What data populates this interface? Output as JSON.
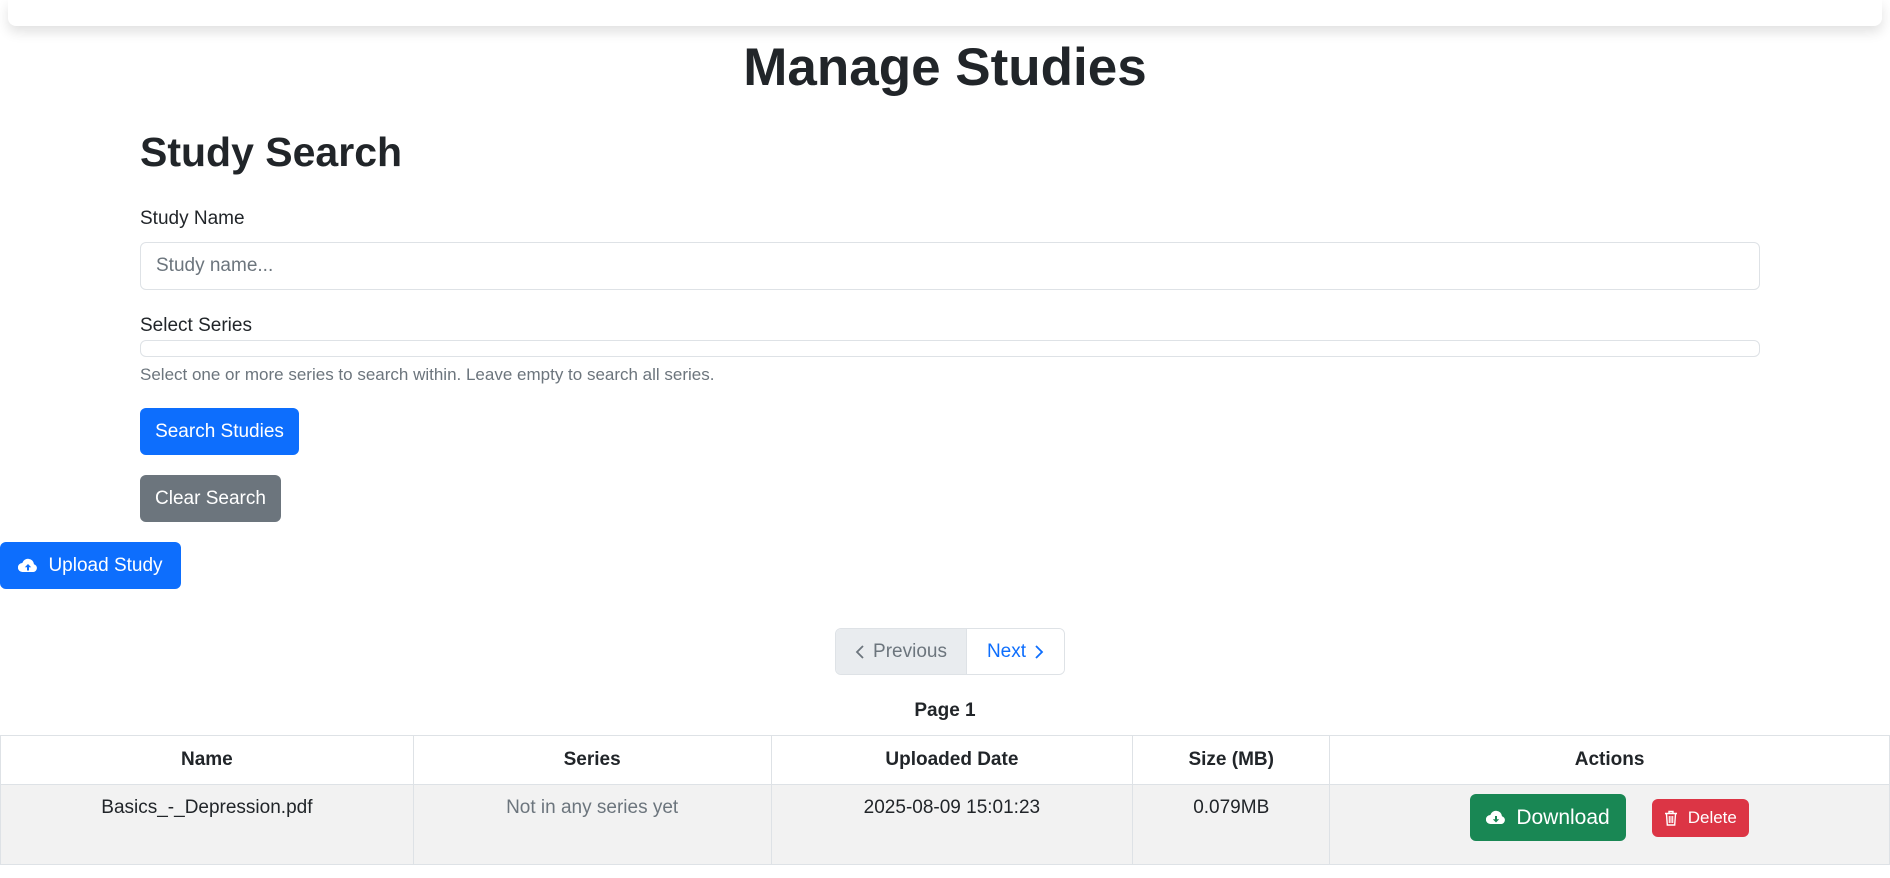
{
  "page": {
    "title": "Manage Studies"
  },
  "search": {
    "title": "Study Search",
    "name_label": "Study Name",
    "name_placeholder": "Study name...",
    "name_value": "",
    "series_label": "Select Series",
    "series_help": "Select one or more series to search within. Leave empty to search all series.",
    "search_button": "Search Studies",
    "clear_button": "Clear Search"
  },
  "upload": {
    "label": "Upload Study",
    "icon": "cloud-upload-icon"
  },
  "pagination": {
    "previous_label": "Previous",
    "next_label": "Next",
    "page_label": "Page 1"
  },
  "table": {
    "columns": [
      "Name",
      "Series",
      "Uploaded Date",
      "Size (MB)",
      "Actions"
    ],
    "rows": [
      {
        "name": "Basics_-_Depression.pdf",
        "series": "Not in any series yet",
        "uploaded": "2025-08-09 15:01:23",
        "size": "0.079MB",
        "download_label": "Download",
        "delete_label": "Delete"
      }
    ]
  },
  "colors": {
    "primary": "#0d6efd",
    "secondary": "#6c757d",
    "success": "#198754",
    "danger": "#dc3545"
  }
}
